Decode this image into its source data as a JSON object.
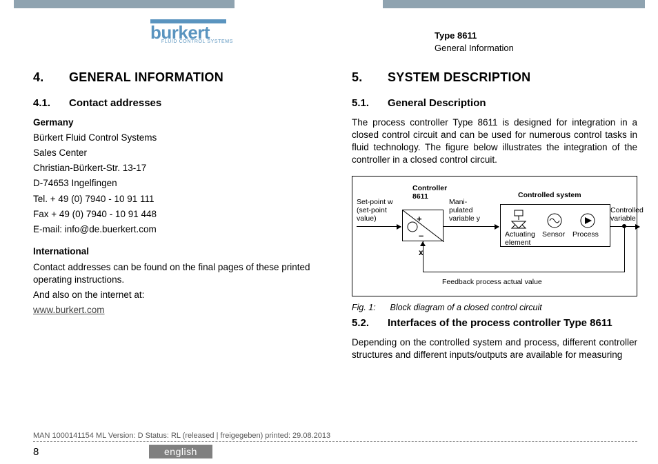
{
  "header": {
    "logo_word": "burkert",
    "logo_tag": "FLUID CONTROL SYSTEMS",
    "type_label": "Type 8611",
    "section_label": "General Information"
  },
  "left": {
    "h1_num": "4.",
    "h1_title": "GENERAL INFORMATION",
    "h2a_num": "4.1.",
    "h2a_title": "Contact addresses",
    "germany_heading": "Germany",
    "addr_line1": "Bürkert Fluid Control Systems",
    "addr_line2": "Sales Center",
    "addr_line3": "Christian-Bürkert-Str. 13-17",
    "addr_line4": "D-74653 Ingelfingen",
    "addr_tel": "Tel.  + 49 (0) 7940 - 10 91 111",
    "addr_fax": "Fax  + 49 (0) 7940 - 10 91 448",
    "addr_email": "E-mail: info@de.buerkert.com",
    "intl_heading": "International",
    "intl_p1": "Contact addresses can be found on the final pages of these printed operating instructions.",
    "intl_p2": "And also on the internet at:",
    "intl_link": "www.burkert.com"
  },
  "right": {
    "h1_num": "5.",
    "h1_title": "SYSTEM DESCRIPTION",
    "h2a_num": "5.1.",
    "h2a_title": "General Description",
    "p1": "The process controller Type 8611 is designed for integration in a closed control circuit and can be used for numerous control tasks in fluid technology. The figure below illustrates the integration of the controller in a closed control circuit.",
    "fig_num": "Fig. 1:",
    "fig_caption": "Block diagram of a closed control circuit",
    "h2b_num": "5.2.",
    "h2b_title": "Interfaces of the process controller Type 8611",
    "p2": "Depending on the controlled system and process, different controller structures and different inputs/outputs are available for measuring"
  },
  "diagram": {
    "setpoint1": "Set-point w",
    "setpoint2": "(set-point",
    "setpoint3": "value)",
    "controller_label1": "Controller",
    "controller_label2": "8611",
    "manip1": "Mani-",
    "manip2": "pulated",
    "manip3": "variable y",
    "controlled_system": "Controlled system",
    "actuating1": "Actuating",
    "actuating2": "element",
    "sensor": "Sensor",
    "process": "Process",
    "controlled1": "Controlled",
    "controlled2": "variable",
    "feedback": "Feedback process actual value",
    "x": "x",
    "plus": "+",
    "minus": "–"
  },
  "footer": {
    "meta": "MAN  1000141154  ML  Version: D Status: RL (released | freigegeben)  printed: 29.08.2013",
    "page": "8",
    "lang": "english"
  }
}
